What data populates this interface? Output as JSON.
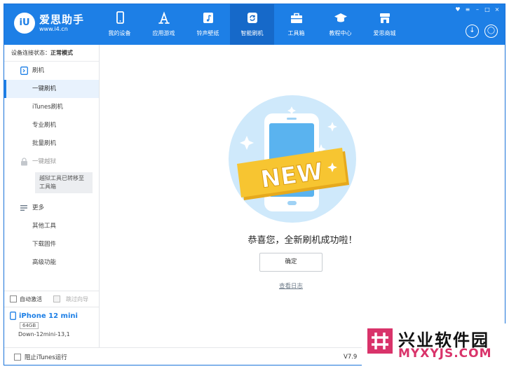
{
  "app": {
    "name": "爱思助手",
    "url": "www.i4.cn",
    "logo_text": "iU"
  },
  "nav": [
    {
      "label": "我的设备",
      "icon": "phone-icon"
    },
    {
      "label": "应用游戏",
      "icon": "app-store-icon"
    },
    {
      "label": "铃声壁纸",
      "icon": "music-icon"
    },
    {
      "label": "智能刷机",
      "icon": "refresh-icon"
    },
    {
      "label": "工具箱",
      "icon": "toolbox-icon"
    },
    {
      "label": "教程中心",
      "icon": "graduation-cap-icon"
    },
    {
      "label": "爱思商城",
      "icon": "store-icon"
    }
  ],
  "nav_active_index": 3,
  "window_controls": [
    "♥",
    "≡",
    "–",
    "□",
    "×"
  ],
  "sidebar": {
    "status_label": "设备连接状态：",
    "status_value": "正常模式",
    "flash_section": "刷机",
    "flash_items": [
      "一键刷机",
      "iTunes刷机",
      "专业刷机",
      "批量刷机"
    ],
    "jailbreak_section": "一键越狱",
    "jailbreak_note": "越狱工具已转移至工具箱",
    "more_section": "更多",
    "more_items": [
      "其他工具",
      "下载固件",
      "高级功能"
    ],
    "auto_activate": "自动激活",
    "skip_guide": "跳过向导"
  },
  "device": {
    "name": "iPhone 12 mini",
    "capacity": "64GB",
    "firmware": "Down-12mini-13,1"
  },
  "main": {
    "badge_text": "NEW",
    "message": "恭喜您，全新刷机成功啦！",
    "ok_button": "确定",
    "log_link": "查看日志"
  },
  "footer": {
    "block_itunes": "阻止iTunes运行",
    "version": "V7.9"
  },
  "watermark": {
    "title": "兴业软件园",
    "subtitle": "MYXYJS.COM"
  },
  "colors": {
    "brand_blue": "#1d7fe6",
    "active_nav": "#1669c9",
    "badge_yellow": "#f7c531",
    "watermark_pink": "#d9336a"
  }
}
